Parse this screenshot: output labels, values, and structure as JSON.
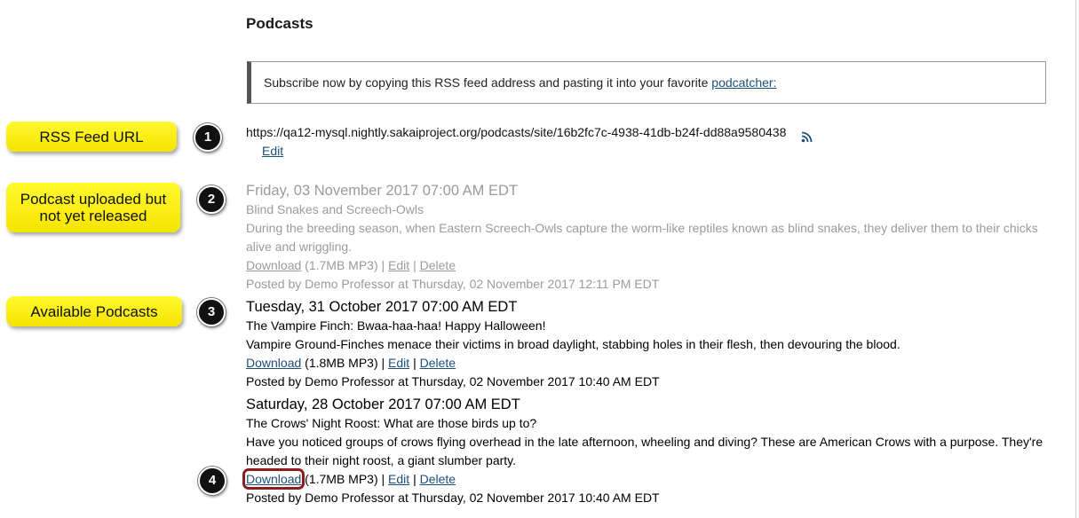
{
  "page": {
    "title": "Podcasts"
  },
  "subscribe": {
    "text": "Subscribe now by copying this RSS feed address and pasting it into your favorite",
    "link": "podcatcher:"
  },
  "feed": {
    "url": "https://qa12-mysql.nightly.sakaiproject.org/podcasts/site/16b2fc7c-4938-41db-b24f-dd88a9580438",
    "edit_label": "Edit",
    "icon": "rss-icon"
  },
  "callouts": [
    {
      "label": "RSS Feed URL",
      "number": "1"
    },
    {
      "label": "Podcast uploaded but not yet released",
      "number": "2"
    },
    {
      "label": "Available Podcasts",
      "number": "3"
    },
    {
      "label": "",
      "number": "4"
    }
  ],
  "episodes": [
    {
      "date": "Friday, 03 November 2017 07:00 AM EDT",
      "title": "Blind Snakes and Screech-Owls",
      "description": "During the breeding season, when Eastern Screech-Owls capture the worm-like reptiles known as blind snakes, they deliver them to their chicks alive and wriggling.",
      "download_label": "Download",
      "size": "(1.7MB MP3)",
      "edit_label": "Edit",
      "delete_label": "Delete",
      "posted": "Posted by Demo Professor at Thursday, 02 November 2017 12:11 PM EDT",
      "released": false
    },
    {
      "date": "Tuesday, 31 October 2017 07:00 AM EDT",
      "title": "The Vampire Finch: Bwaa-haa-haa! Happy Halloween!",
      "description": "Vampire Ground-Finches menace their victims in broad daylight, stabbing holes in their flesh, then devouring the blood.",
      "download_label": "Download",
      "size": "(1.8MB MP3)",
      "edit_label": "Edit",
      "delete_label": "Delete",
      "posted": "Posted by Demo Professor at Thursday, 02 November 2017 10:40 AM EDT",
      "released": true
    },
    {
      "date": "Saturday, 28 October 2017 07:00 AM EDT",
      "title": "The Crows' Night Roost: What are those birds up to?",
      "description": "Have you noticed groups of crows flying overhead in the late afternoon, wheeling and diving? These are American Crows with a purpose. They're headed to their night roost, a giant slumber party.",
      "download_label": "Download",
      "size": "(1.7MB MP3)",
      "edit_label": "Edit",
      "delete_label": "Delete",
      "posted": "Posted by Demo Professor at Thursday, 02 November 2017 10:40 AM EDT",
      "released": true
    }
  ],
  "separator": "|"
}
